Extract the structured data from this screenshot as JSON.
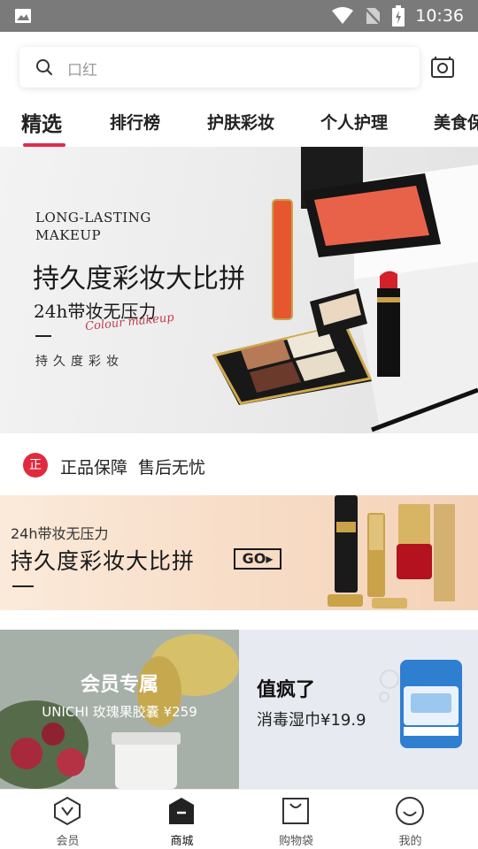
{
  "status_bar": {
    "time": "10:36"
  },
  "search": {
    "placeholder": "口红"
  },
  "tabs": [
    {
      "label": "精选",
      "active": true
    },
    {
      "label": "排行榜"
    },
    {
      "label": "护肤彩妆"
    },
    {
      "label": "个人护理"
    },
    {
      "label": "美食保"
    }
  ],
  "hero": {
    "en_line1": "LONG-LASTING",
    "en_line2": "MAKEUP",
    "title": "持久度彩妆大比拼",
    "subtitle": "24h带妆无压力",
    "script": "Colour makeup",
    "small": "持久度彩妆"
  },
  "guarantee": {
    "badge": "正",
    "text": "正品保障  售后无忧"
  },
  "banner2": {
    "subtitle": "24h带妆无压力",
    "title": "持久度彩妆大比拼",
    "go_label": "GO▸"
  },
  "promo_left": {
    "title": "会员专属",
    "subtitle": "UNICHI 玫瑰果胶囊 ¥259"
  },
  "promo_right": {
    "title": "值疯了",
    "subtitle": "消毒湿巾¥19.9"
  },
  "bottom_nav": [
    {
      "label": "会员",
      "icon": "vip-icon"
    },
    {
      "label": "商城",
      "icon": "shop-icon",
      "active": true
    },
    {
      "label": "购物袋",
      "icon": "bag-icon"
    },
    {
      "label": "我的",
      "icon": "profile-icon"
    }
  ],
  "colors": {
    "accent": "#e02b4f",
    "badge": "#e02b3f",
    "status_bar": "#7a7a7a"
  }
}
